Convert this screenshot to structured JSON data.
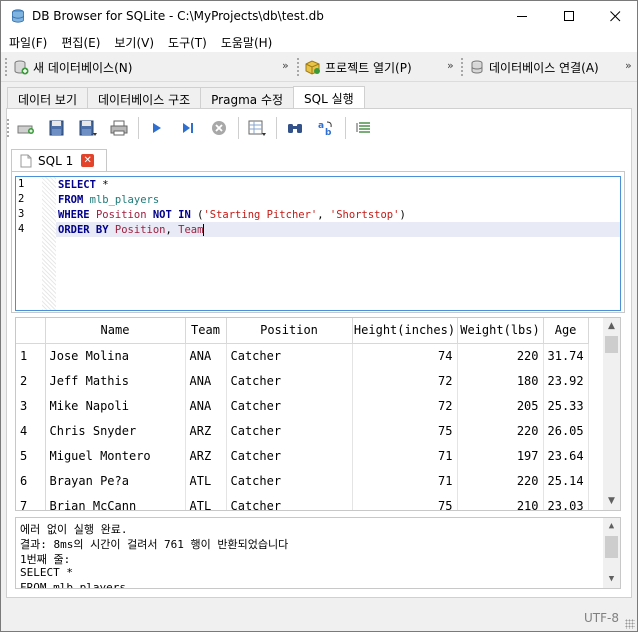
{
  "window": {
    "title": "DB Browser for SQLite - C:\\MyProjects\\db\\test.db",
    "minimize": "—",
    "maximize": "☐",
    "close": "✕"
  },
  "menu": [
    "파일(F)",
    "편집(E)",
    "보기(V)",
    "도구(T)",
    "도움말(H)"
  ],
  "toolbar": {
    "new_db": "새 데이터베이스(N)",
    "open_project": "프로젝트 열기(P)",
    "connect_db": "데이터베이스 연결(A)",
    "more": "»"
  },
  "tabs": [
    "데이터 보기",
    "데이터베이스 구조",
    "Pragma 수정",
    "SQL 실행"
  ],
  "sql_tab": {
    "label": "SQL 1"
  },
  "editor": {
    "line_numbers": [
      "1",
      "2",
      "3",
      "4"
    ],
    "lines": [
      [
        {
          "t": "kw",
          "v": "SELECT"
        },
        {
          "t": "",
          "v": " *"
        }
      ],
      [
        {
          "t": "kw",
          "v": "FROM"
        },
        {
          "t": "",
          "v": " "
        },
        {
          "t": "tbl",
          "v": "mlb_players"
        }
      ],
      [
        {
          "t": "kw",
          "v": "WHERE"
        },
        {
          "t": "",
          "v": " "
        },
        {
          "t": "col",
          "v": "Position"
        },
        {
          "t": "",
          "v": " "
        },
        {
          "t": "kw",
          "v": "NOT IN"
        },
        {
          "t": "",
          "v": " ("
        },
        {
          "t": "str",
          "v": "'Starting Pitcher'"
        },
        {
          "t": "",
          "v": ", "
        },
        {
          "t": "str",
          "v": "'Shortstop'"
        },
        {
          "t": "",
          "v": ")"
        }
      ],
      [
        {
          "t": "kw",
          "v": "ORDER BY"
        },
        {
          "t": "",
          "v": " "
        },
        {
          "t": "col",
          "v": "Position"
        },
        {
          "t": "",
          "v": ", "
        },
        {
          "t": "col",
          "v": "Team"
        }
      ]
    ]
  },
  "results": {
    "columns": [
      "Name",
      "Team",
      "Position",
      "Height(inches)",
      "Weight(lbs)",
      "Age"
    ],
    "rows": [
      [
        "1",
        "Jose Molina",
        "ANA",
        "Catcher",
        "74",
        "220",
        "31.74"
      ],
      [
        "2",
        "Jeff Mathis",
        "ANA",
        "Catcher",
        "72",
        "180",
        "23.92"
      ],
      [
        "3",
        "Mike Napoli",
        "ANA",
        "Catcher",
        "72",
        "205",
        "25.33"
      ],
      [
        "4",
        "Chris Snyder",
        "ARZ",
        "Catcher",
        "75",
        "220",
        "26.05"
      ],
      [
        "5",
        "Miguel Montero",
        "ARZ",
        "Catcher",
        "71",
        "197",
        "23.64"
      ],
      [
        "6",
        "Brayan Pe?a",
        "ATL",
        "Catcher",
        "71",
        "220",
        "25.14"
      ],
      [
        "7",
        "Brian McCann",
        "ATL",
        "Catcher",
        "75",
        "210",
        "23.03"
      ]
    ]
  },
  "messages": [
    "에러 없이 실행 완료.",
    "결과: 8ms의 시간이 걸려서 761 행이 반환되었습니다",
    "1번째 줄:",
    "SELECT *",
    "FROM mlb_players"
  ],
  "status": {
    "encoding": "UTF-8"
  },
  "colors": {
    "keyword": "#00008b",
    "table": "#1d7a7a",
    "column": "#a02040",
    "string": "#c41a16",
    "focus_border": "#4a90d9"
  }
}
